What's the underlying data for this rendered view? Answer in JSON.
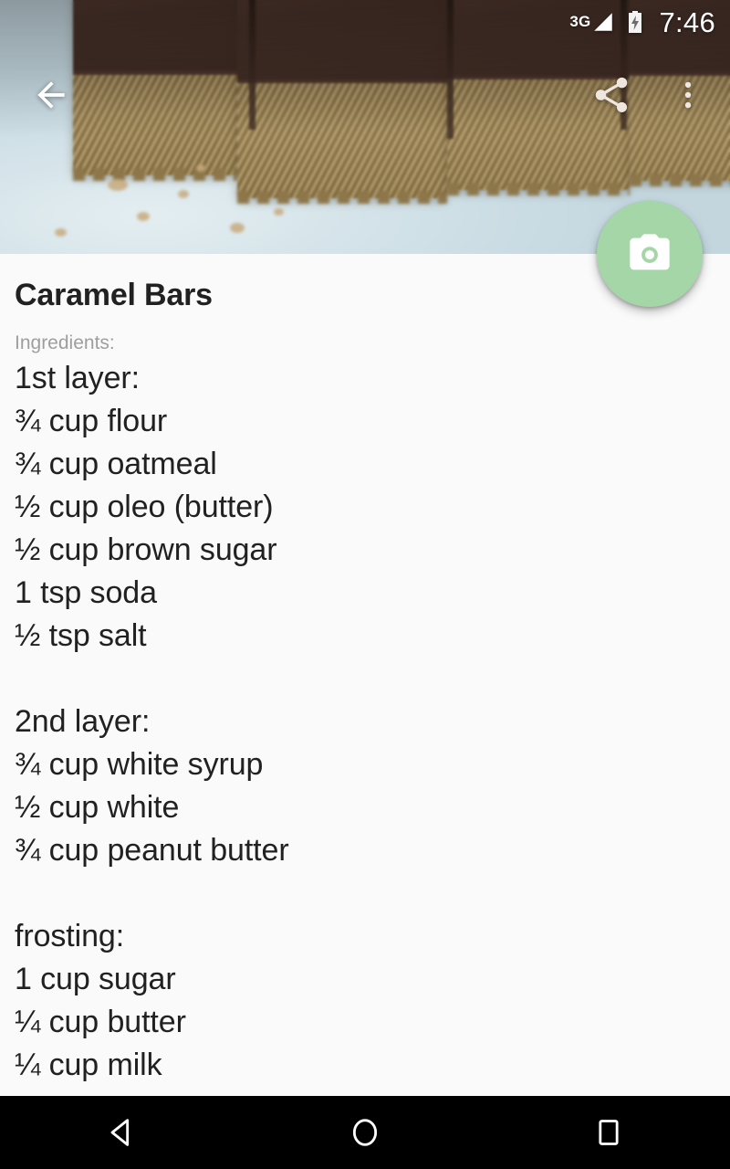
{
  "status_bar": {
    "network_type": "3G",
    "signal_icon": "signal-bars-icon",
    "battery_icon": "battery-charging-icon",
    "clock": "7:46"
  },
  "toolbar": {
    "back_icon": "back-arrow-icon",
    "share_icon": "share-icon",
    "overflow_icon": "overflow-menu-icon"
  },
  "fab": {
    "icon": "camera-icon",
    "color": "#A5D6A7"
  },
  "hero": {
    "photo_alt": "caramel bars with chocolate topping on a plate"
  },
  "recipe": {
    "title": "Caramel Bars",
    "ingredients_label": "Ingredients:",
    "ingredients_text": "1st layer:\n¾ cup flour\n¾ cup oatmeal\n½ cup oleo (butter)\n½ cup brown sugar\n1 tsp soda\n½ tsp salt\n\n2nd layer:\n¾ cup white syrup\n½ cup white\n¾ cup peanut butter\n\nfrosting:\n1 cup sugar\n¼ cup butter\n¼ cup milk",
    "sections": [
      {
        "heading": "1st layer:",
        "items": [
          "¾ cup flour",
          "¾ cup oatmeal",
          "½ cup oleo (butter)",
          "½ cup brown sugar",
          "1 tsp soda",
          "½ tsp salt"
        ]
      },
      {
        "heading": "2nd layer:",
        "items": [
          "¾ cup white syrup",
          "½ cup white",
          "¾ cup peanut butter"
        ]
      },
      {
        "heading": "frosting:",
        "items": [
          "1 cup sugar",
          "¼ cup butter",
          "¼ cup milk"
        ]
      }
    ]
  },
  "nav_bar": {
    "back_icon": "nav-back-triangle-icon",
    "home_icon": "nav-home-circle-icon",
    "recents_icon": "nav-recents-square-icon"
  },
  "colors": {
    "accent": "#A5D6A7",
    "background": "#FAFAFA",
    "text_primary": "#212121",
    "text_secondary": "#9E9E9E",
    "nav_bar": "#000000"
  }
}
